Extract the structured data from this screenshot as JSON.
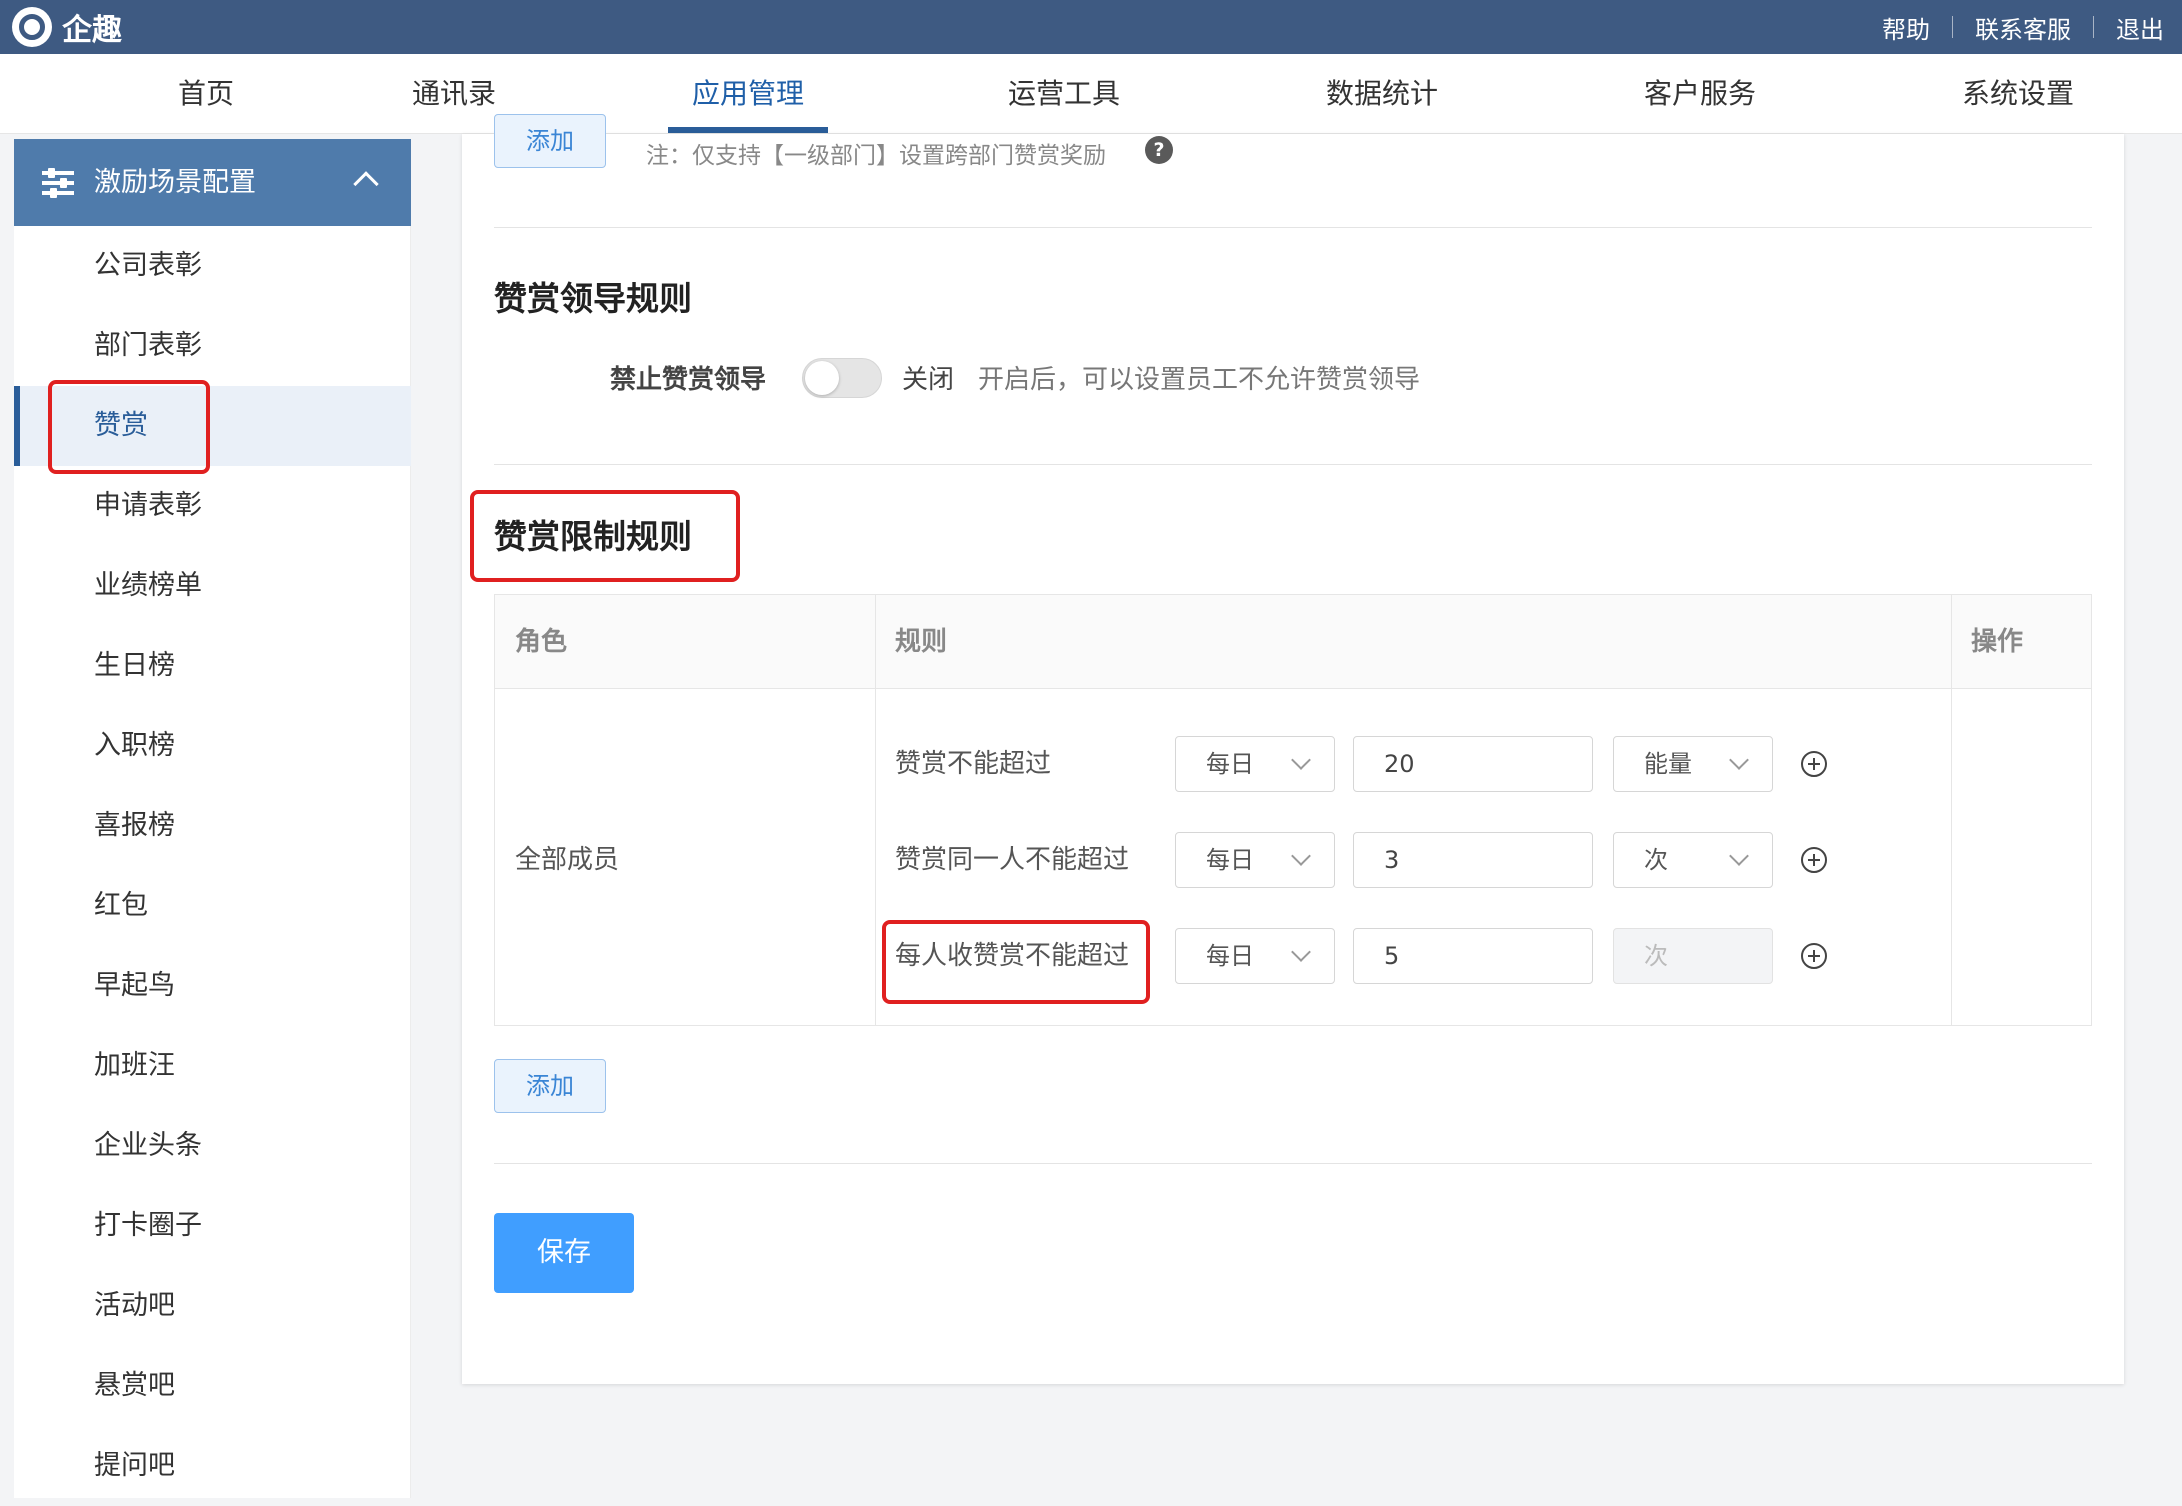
{
  "app": {
    "brand": "企趣"
  },
  "topbar": {
    "links": [
      "帮助",
      "联系客服",
      "退出"
    ]
  },
  "nav": {
    "items": [
      "首页",
      "通讯录",
      "应用管理",
      "运营工具",
      "数据统计",
      "客户服务",
      "系统设置"
    ],
    "active": "应用管理"
  },
  "sidebar": {
    "group_title": "激励场景配置",
    "items": [
      "公司表彰",
      "部门表彰",
      "赞赏",
      "申请表彰",
      "业绩榜单",
      "生日榜",
      "入职榜",
      "喜报榜",
      "红包",
      "早起鸟",
      "加班汪",
      "企业头条",
      "打卡圈子",
      "活动吧",
      "悬赏吧",
      "提问吧"
    ],
    "active": "赞赏"
  },
  "top_section": {
    "add_button": "添加",
    "note": "注：仅支持【一级部门】设置跨部门赞赏奖励",
    "help_glyph": "?"
  },
  "leader_rule": {
    "title": "赞赏领导规则",
    "toggle_label": "禁止赞赏领导",
    "toggle_state": "关闭",
    "description": "开启后，可以设置员工不允许赞赏领导"
  },
  "limit_rule": {
    "title": "赞赏限制规则",
    "headers": {
      "role": "角色",
      "rule": "规则",
      "action": "操作"
    },
    "role": "全部成员",
    "rows": [
      {
        "label": "赞赏不能超过",
        "period": "每日",
        "value": "20",
        "unit": "能量",
        "unit_disabled": false
      },
      {
        "label": "赞赏同一人不能超过",
        "period": "每日",
        "value": "3",
        "unit": "次",
        "unit_disabled": false
      },
      {
        "label": "每人收赞赏不能超过",
        "period": "每日",
        "value": "5",
        "unit": "次",
        "unit_disabled": true
      }
    ],
    "add_button": "添加"
  },
  "save_button": "保存",
  "colors": {
    "topbar": "#3e5a82",
    "sidebar_header": "#4f7bab",
    "primary": "#409eff",
    "highlight": "#e02020"
  }
}
